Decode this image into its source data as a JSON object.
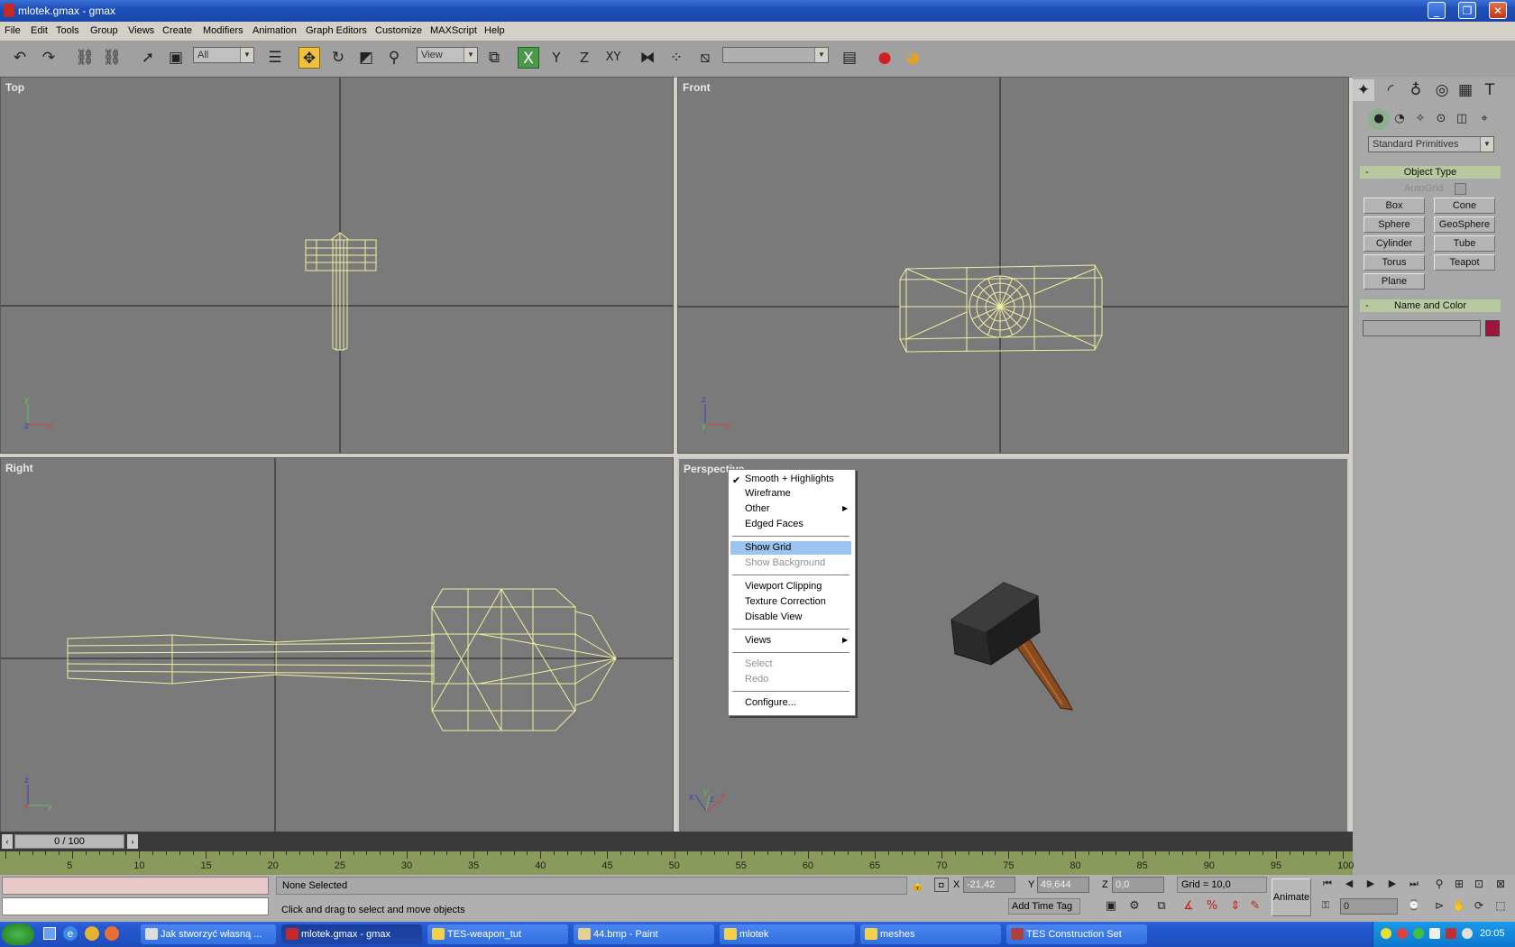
{
  "window": {
    "title": "mlotek.gmax - gmax",
    "controls": [
      "minimize",
      "restore",
      "close"
    ]
  },
  "menu": [
    "File",
    "Edit",
    "Tools",
    "Group",
    "Views",
    "Create",
    "Modifiers",
    "Animation",
    "Graph Editors",
    "Customize",
    "MAXScript",
    "Help"
  ],
  "toolbar": {
    "selection_filter": "All",
    "reference_coord": "View",
    "named_selection": "",
    "axis_x": "X",
    "axis_y": "Y",
    "axis_z": "Z",
    "axis_xy": "XY"
  },
  "viewports": {
    "top": "Top",
    "front": "Front",
    "right": "Right",
    "perspective": "Perspective"
  },
  "context_menu": {
    "items": [
      {
        "label": "Smooth + Highlights",
        "checked": true
      },
      {
        "label": "Wireframe"
      },
      {
        "label": "Other",
        "submenu": true
      },
      {
        "label": "Edged Faces"
      },
      {
        "label": "Show Grid",
        "highlighted": true
      },
      {
        "label": "Show Background",
        "disabled": true
      },
      {
        "label": "Viewport Clipping"
      },
      {
        "label": "Texture Correction"
      },
      {
        "label": "Disable View"
      },
      {
        "label": "Views",
        "submenu": true
      },
      {
        "label": "Select",
        "disabled": true
      },
      {
        "label": "Redo",
        "disabled": true
      },
      {
        "label": "Configure..."
      }
    ],
    "check_mark": "✔",
    "submenu_arrow": "▶"
  },
  "command_panel": {
    "category_dropdown": "Standard Primitives",
    "object_type_header": "Object Type",
    "autogrid_label": "AutoGrid",
    "buttons": [
      "Box",
      "Cone",
      "Sphere",
      "GeoSphere",
      "Cylinder",
      "Tube",
      "Torus",
      "Teapot",
      "Plane"
    ],
    "name_color_header": "Name and Color",
    "object_color": "#a0143c",
    "collapse_sign": "-"
  },
  "timeline": {
    "slider_label": "0 / 100",
    "ticks": [
      "5",
      "10",
      "15",
      "20",
      "25",
      "30",
      "35",
      "40",
      "45",
      "50",
      "55",
      "60",
      "65",
      "70",
      "75",
      "80",
      "85",
      "90",
      "95",
      "100"
    ]
  },
  "status": {
    "selection": "None Selected",
    "prompt": "Click and drag to select and move objects",
    "x_label": "X",
    "x_value": "-21,42",
    "y_label": "Y",
    "y_value": "49,644",
    "z_label": "Z",
    "z_value": "0,0",
    "grid": "Grid = 10,0",
    "add_time_tag": "Add Time Tag",
    "animate": "Animate",
    "frame": "0"
  },
  "taskbar": {
    "tasks": [
      {
        "label": "Jak stworzyć własną ...",
        "active": false
      },
      {
        "label": "mlotek.gmax - gmax",
        "active": true
      },
      {
        "label": "TES-weapon_tut",
        "active": false
      },
      {
        "label": "44.bmp - Paint",
        "active": false
      },
      {
        "label": "mlotek",
        "active": false
      },
      {
        "label": "meshes",
        "active": false
      },
      {
        "label": "TES Construction Set",
        "active": false
      }
    ],
    "clock": "20:05"
  },
  "colors": {
    "viewport_bg": "#7a7a7a",
    "wireframe": "#f0f0a0",
    "highlight": "#9cc4f0",
    "timeline": "#8a9a5a"
  }
}
